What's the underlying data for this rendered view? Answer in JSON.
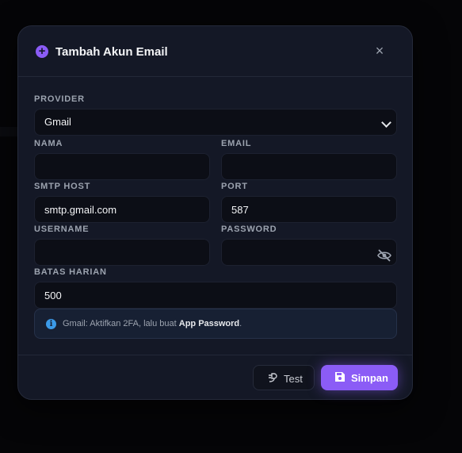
{
  "modal": {
    "title": "Tambah Akun Email",
    "close_label": "×"
  },
  "form": {
    "provider": {
      "label": "PROVIDER",
      "value": "Gmail",
      "options": [
        "Gmail"
      ]
    },
    "nama": {
      "label": "NAMA",
      "value": ""
    },
    "email": {
      "label": "EMAIL",
      "value": ""
    },
    "smtp_host": {
      "label": "SMTP HOST",
      "value": "smtp.gmail.com"
    },
    "port": {
      "label": "PORT",
      "value": "587"
    },
    "username": {
      "label": "USERNAME",
      "value": ""
    },
    "password": {
      "label": "PASSWORD",
      "value": ""
    },
    "batas_harian": {
      "label": "BATAS HARIAN",
      "value": "500"
    }
  },
  "info": {
    "prefix": "Gmail: Aktifkan 2FA, lalu buat ",
    "bold": "App Password",
    "suffix": "."
  },
  "buttons": {
    "test_label": "Test",
    "save_label": "Simpan"
  },
  "icons": {
    "title": "plus-circle-icon",
    "close": "close-icon",
    "password_toggle": "eye-off-icon",
    "info": "info-icon",
    "test": "plug-icon",
    "save": "floppy-disk-icon"
  },
  "colors": {
    "accent": "#8b5cf6",
    "modal_bg": "#141826",
    "input_bg": "#0c0e16",
    "info_bg": "#172033",
    "info_icon": "#3b9ae8"
  }
}
